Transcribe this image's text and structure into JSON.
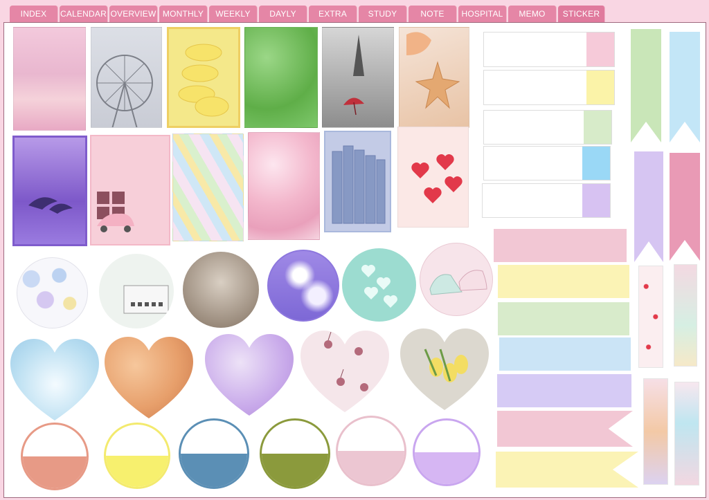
{
  "tabs": [
    "INDEX",
    "CALENDAR",
    "OVERVIEW",
    "MONTHLY",
    "WEEKLY",
    "DAYLY",
    "EXTRA",
    "STUDY",
    "NOTE",
    "HOSPITAL",
    "MEMO",
    "STICKER"
  ],
  "active_tab": "STICKER",
  "stickers": {
    "photo_cards": [
      "beach-sunset",
      "ferris-wheel",
      "macarons",
      "clovers",
      "eiffel-street-umbrella",
      "starfish",
      "dolphins",
      "pink-car-gift",
      "feathers",
      "flowers",
      "books",
      "hearts-jar"
    ],
    "photo_circles": [
      "pastel-dots",
      "typewriter",
      "dried-flowers",
      "clouds",
      "hearts-teal",
      "sneakers"
    ],
    "hearts": [
      "blue-tree",
      "orange-roses",
      "purple-hearts",
      "cherries",
      "tulips"
    ],
    "half_circles": [
      {
        "ring": "#e79a86",
        "fill": "#e79a86"
      },
      {
        "ring": "#f3ea6e",
        "fill": "#f7f06e"
      },
      {
        "ring": "#5b8fb5",
        "fill": "#5b8fb5"
      },
      {
        "ring": "#8b9a3c",
        "fill": "#8b9a3c"
      },
      {
        "ring": "#e9c0cc",
        "fill": "#ecc6d2"
      },
      {
        "ring": "#c9a6ef",
        "fill": "#d6b6f3"
      }
    ],
    "tab_notes": [
      "#f6cad9",
      "#fbf3a8",
      "#d7ebc9",
      "#9ad8f6",
      "#d7c2f2"
    ],
    "ribbons": [
      "#c9e6b8",
      "#c3e6f7",
      "#d6c5f2",
      "#e99ab5"
    ],
    "bars": [
      "#f2c7d4",
      "#fbf3b5",
      "#d8ebcb",
      "#cbe4f6",
      "#d6cbf5",
      "#f2c7d4",
      "#fbf3b5"
    ]
  }
}
